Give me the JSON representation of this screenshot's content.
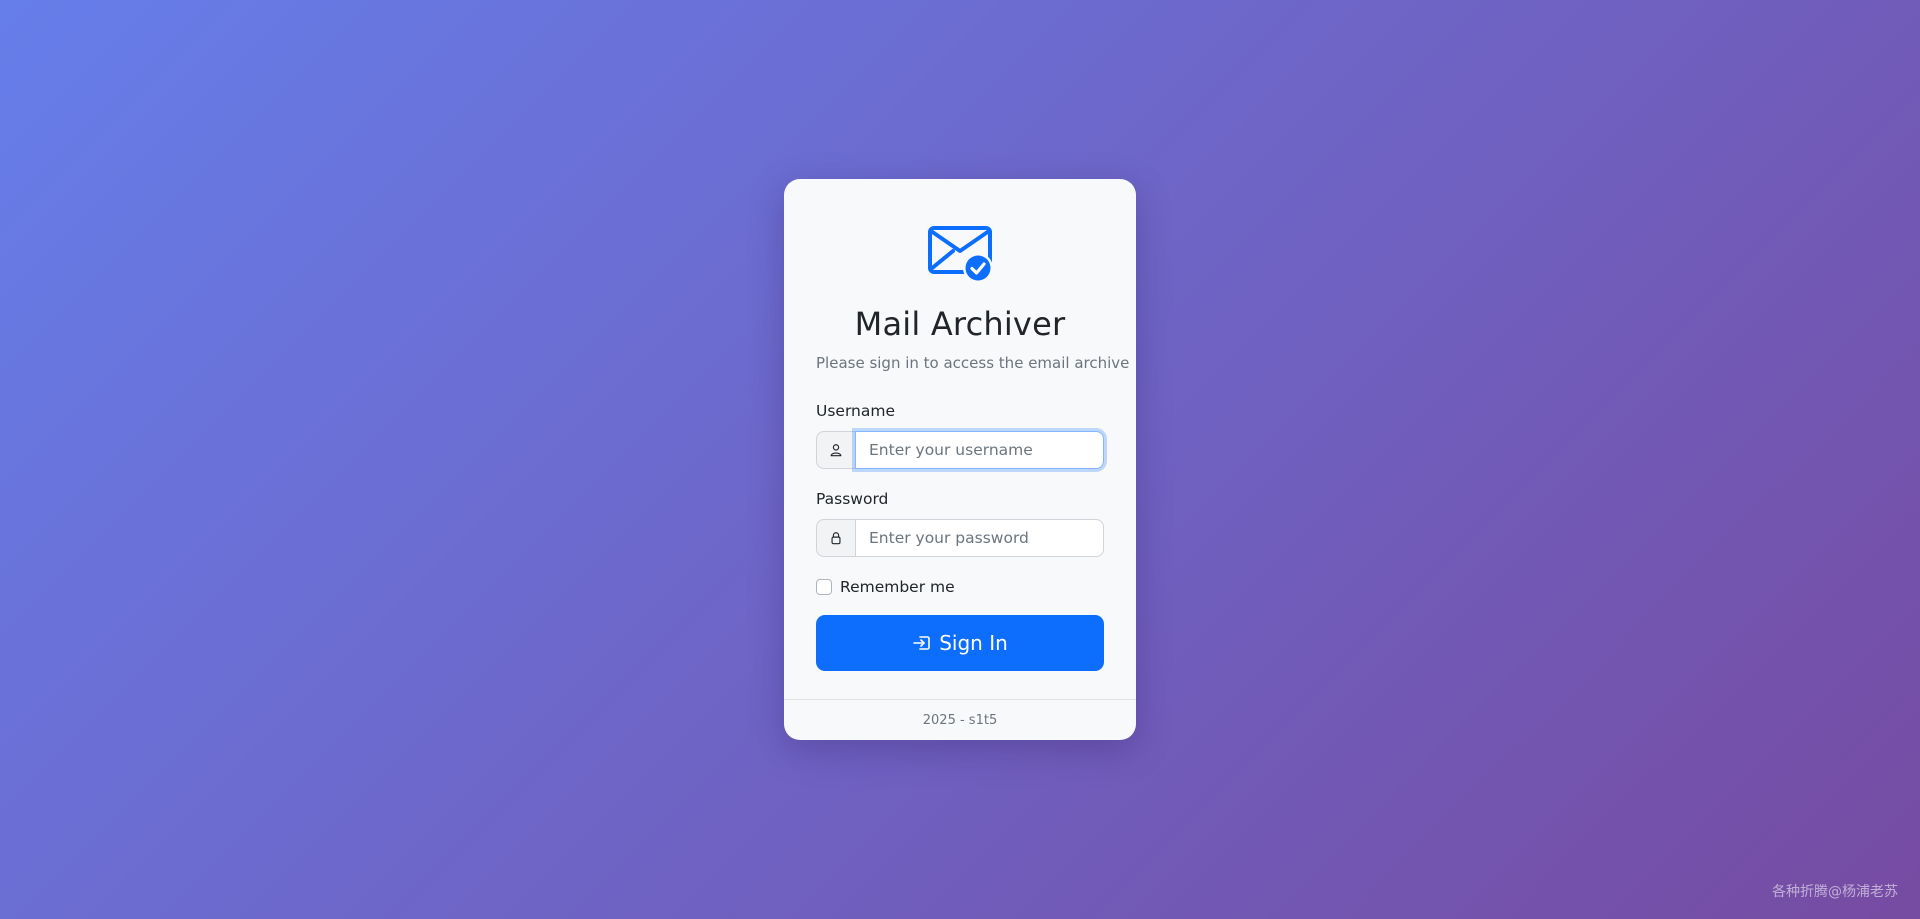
{
  "app": {
    "title": "Mail Archiver",
    "subtitle": "Please sign in to access the email archive",
    "logo_icon": "envelope-check-icon",
    "accent_color": "#0d6efd"
  },
  "form": {
    "username": {
      "label": "Username",
      "placeholder": "Enter your username",
      "value": "",
      "icon": "person-icon"
    },
    "password": {
      "label": "Password",
      "placeholder": "Enter your password",
      "value": "",
      "icon": "lock-icon"
    },
    "remember": {
      "label": "Remember me",
      "checked": false
    },
    "submit": {
      "label": "Sign In",
      "icon": "box-arrow-in-right-icon"
    }
  },
  "footer": {
    "text": "2025 - s1t5"
  },
  "watermark": {
    "text": "各种折腾@杨浦老苏"
  }
}
